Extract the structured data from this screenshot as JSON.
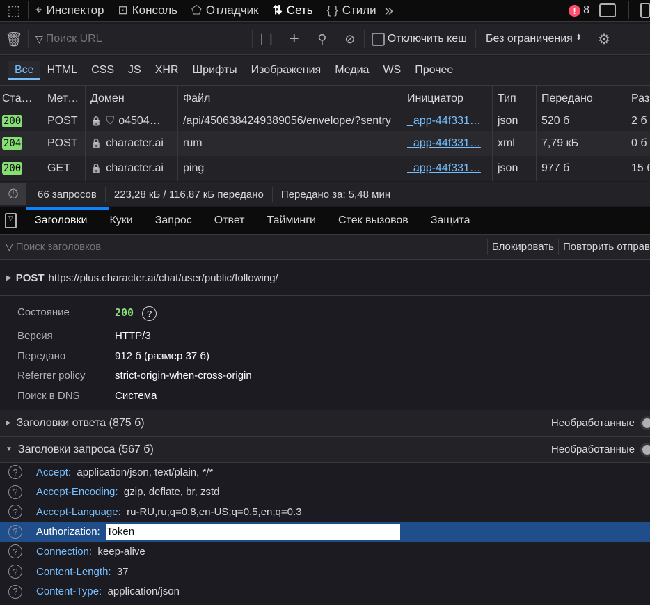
{
  "toolbar": {
    "tabs": [
      {
        "label": "Инспектор",
        "icon": "inspector-icon"
      },
      {
        "label": "Консоль",
        "icon": "console-icon"
      },
      {
        "label": "Отладчик",
        "icon": "debugger-icon"
      },
      {
        "label": "Сеть",
        "icon": "network-icon",
        "selected": true
      },
      {
        "label": "Стили",
        "icon": "styles-icon"
      }
    ],
    "error_count": "8"
  },
  "filter": {
    "placeholder": "Поиск URL",
    "disable_cache": "Отключить кеш",
    "throttle": "Без ограничения"
  },
  "types": [
    "Все",
    "HTML",
    "CSS",
    "JS",
    "XHR",
    "Шрифты",
    "Изображения",
    "Медиа",
    "WS",
    "Прочее"
  ],
  "columns": [
    "Ста…",
    "Мет…",
    "Домен",
    "Файл",
    "Инициатор",
    "Тип",
    "Передано",
    "Раз"
  ],
  "requests": [
    {
      "status": "200",
      "method": "POST",
      "domain": "o4504…",
      "file": "/api/4506384249389056/envelope/?sentry",
      "initiator": "_app-44f331…",
      "type": "json",
      "transferred": "520 б",
      "size": "2 б"
    },
    {
      "status": "204",
      "method": "POST",
      "domain": "character.ai",
      "file": "rum",
      "initiator": "_app-44f331…",
      "type": "xml",
      "transferred": "7,79 кБ",
      "size": "0 б"
    },
    {
      "status": "200",
      "method": "GET",
      "domain": "character.ai",
      "file": "ping",
      "initiator": "_app-44f331…",
      "type": "json",
      "transferred": "977 б",
      "size": "15 б"
    }
  ],
  "statusbar": {
    "requests": "66 запросов",
    "transferred": "223,28 кБ / 116,87 кБ передано",
    "time": "Передано за: 5,48 мин"
  },
  "detail_tabs": [
    "Заголовки",
    "Куки",
    "Запрос",
    "Ответ",
    "Тайминги",
    "Стек вызовов",
    "Защита"
  ],
  "header_search": {
    "placeholder": "Поиск заголовков",
    "block": "Блокировать",
    "resend": "Повторить отправ"
  },
  "request": {
    "method": "POST",
    "url": "https://plus.character.ai/chat/user/public/following/"
  },
  "summary": [
    {
      "k": "Состояние",
      "v": "200"
    },
    {
      "k": "Версия",
      "v": "HTTP/3"
    },
    {
      "k": "Передано",
      "v": "912 б (размер 37 б)"
    },
    {
      "k": "Referrer policy",
      "v": "strict-origin-when-cross-origin"
    },
    {
      "k": "Поиск в DNS",
      "v": "Система"
    }
  ],
  "sections": {
    "response": "Заголовки ответа (875 б)",
    "request": "Заголовки запроса (567 б)",
    "raw": "Необработанные"
  },
  "request_headers": [
    {
      "n": "Accept:",
      "v": "application/json, text/plain, */*"
    },
    {
      "n": "Accept-Encoding:",
      "v": "gzip, deflate, br, zstd"
    },
    {
      "n": "Accept-Language:",
      "v": "ru-RU,ru;q=0.8,en-US;q=0.5,en;q=0.3"
    },
    {
      "n": "Authorization:",
      "v": "Token",
      "selected": true
    },
    {
      "n": "Connection:",
      "v": "keep-alive"
    },
    {
      "n": "Content-Length:",
      "v": "37"
    },
    {
      "n": "Content-Type:",
      "v": "application/json"
    }
  ],
  "colors": {
    "accent": "#75bfff",
    "success": "#86de74",
    "selection": "#204e8a",
    "error": "#ff4f6d"
  }
}
